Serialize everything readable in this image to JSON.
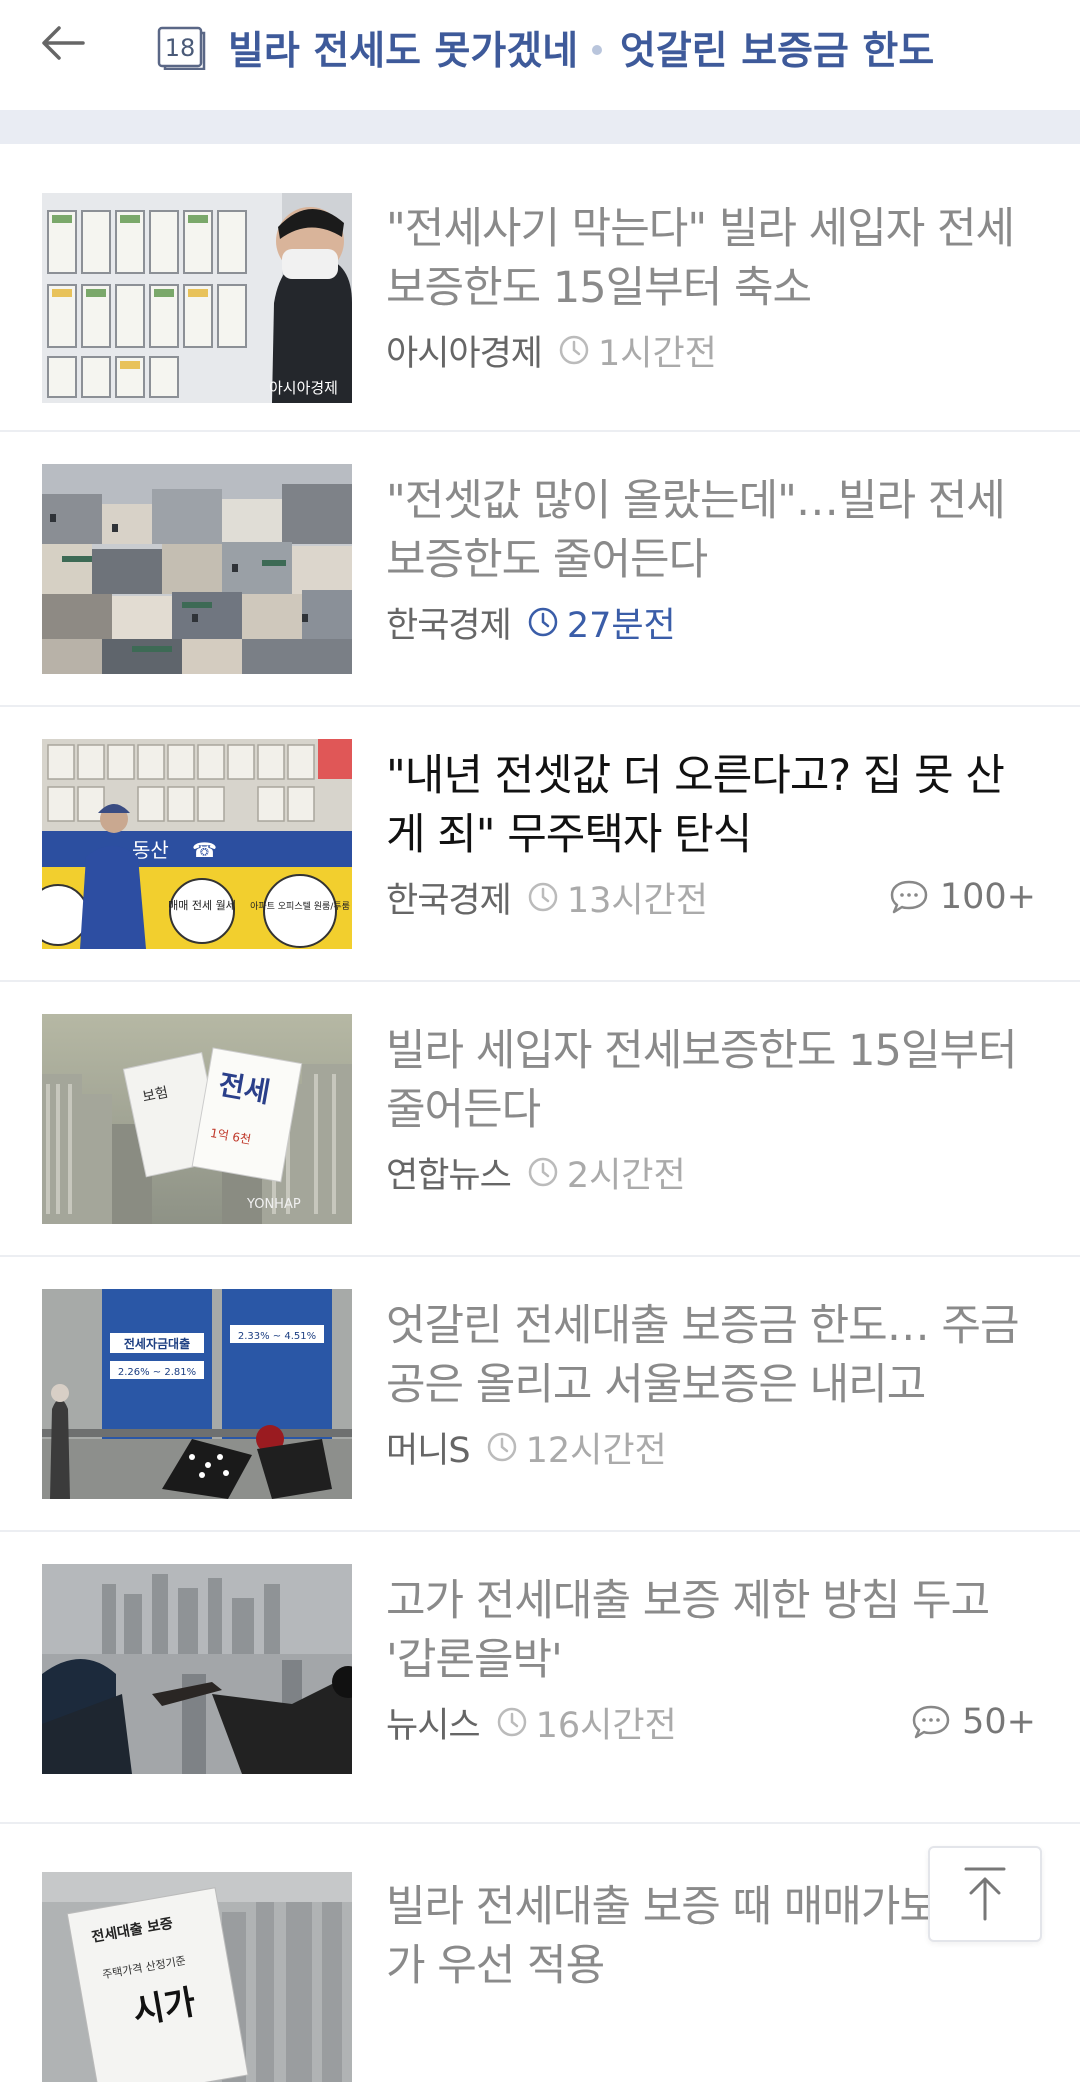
{
  "header": {
    "back_icon": "arrow-left-icon",
    "issue_number": "18",
    "title": "빌라 전세도 못가겠네",
    "title2": "엇갈린 보증금 한도",
    "accent_color": "#3e5a9a"
  },
  "articles": [
    {
      "headline": "\"전세사기 막는다\" 빌라 세입자 전세 보증한도 15일부터 축소",
      "press": "아시아경제",
      "time": "1시간전",
      "time_highlight": false,
      "comments": "",
      "read": true
    },
    {
      "headline": "\"전셋값 많이 올랐는데\"…빌라 전세 보증한도 줄어든다",
      "press": "한국경제",
      "time": "27분전",
      "time_highlight": true,
      "comments": "",
      "read": true
    },
    {
      "headline": "\"내년 전셋값 더 오른다고? 집 못 산 게 죄\" 무주택자 탄식",
      "press": "한국경제",
      "time": "13시간전",
      "time_highlight": false,
      "comments": "100+",
      "read": false
    },
    {
      "headline": "빌라 세입자 전세보증한도 15일부터 줄어든다",
      "press": "연합뉴스",
      "time": "2시간전",
      "time_highlight": false,
      "comments": "",
      "read": true
    },
    {
      "headline": "엇갈린 전세대출 보증금 한도… 주금공은 올리고 서울보증은 내리고",
      "press": "머니S",
      "time": "12시간전",
      "time_highlight": false,
      "comments": "",
      "read": true
    },
    {
      "headline": "고가 전세대출 보증 제한 방침 두고 '갑론을박'",
      "press": "뉴시스",
      "time": "16시간전",
      "time_highlight": false,
      "comments": "50+",
      "read": true
    },
    {
      "headline": "빌라 전세대출 보증 때 매매가보다 시가 우선 적용",
      "press": "",
      "time": "",
      "time_highlight": false,
      "comments": "",
      "read": true
    }
  ],
  "thumb_text": {
    "t1_watermark": "아시아경제",
    "t3_shop": "동산",
    "t3_sign1": "매매 전세 월세",
    "t3_sign2": "아파트 오피스텔 원룸/투룸",
    "t4_doc1": "보험",
    "t4_doc2": "전세",
    "t4_doc3": "1억 6천",
    "t4_watermark": "YONHAP",
    "t5_board1": "전세자금대출",
    "t5_rate1": "2.26% ~ 2.81%",
    "t5_rate2": "2.33% ~ 4.51%",
    "t7_doc1": "전세대출 보증",
    "t7_doc2": "주택가격 산정기준",
    "t7_doc3": "시가"
  },
  "scroll_top_icon": "arrow-up-to-top-icon"
}
